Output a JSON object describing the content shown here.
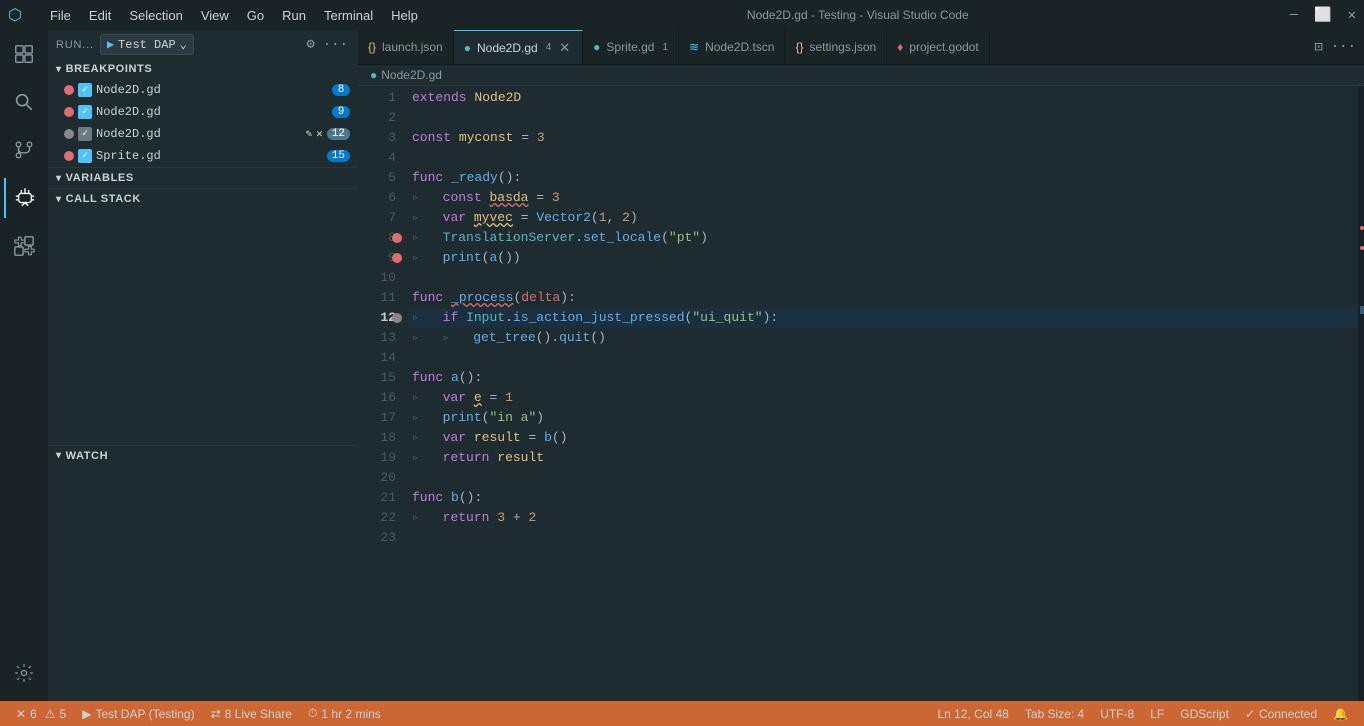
{
  "titleBar": {
    "title": "Node2D.gd - Testing - Visual Studio Code",
    "menu": [
      "File",
      "Edit",
      "Selection",
      "View",
      "Go",
      "Run",
      "Terminal",
      "Help"
    ]
  },
  "activityBar": {
    "icons": [
      {
        "name": "explorer-icon",
        "symbol": "⬜",
        "active": false
      },
      {
        "name": "search-icon",
        "symbol": "🔍",
        "active": false
      },
      {
        "name": "source-control-icon",
        "symbol": "⑂",
        "active": false
      },
      {
        "name": "debug-icon",
        "symbol": "▷",
        "active": true
      },
      {
        "name": "extensions-icon",
        "symbol": "⊞",
        "active": false
      }
    ],
    "bottom": [
      {
        "name": "settings-icon",
        "symbol": "⚙"
      }
    ]
  },
  "sidebar": {
    "runLabel": "RUN...",
    "configLabel": "Test DAP",
    "breakpointsTitle": "BREAKPOINTS",
    "variablesTitle": "VARIABLES",
    "callStackTitle": "CALL STACK",
    "watchTitle": "WATCH",
    "breakpoints": [
      {
        "file": "Node2D.gd",
        "checked": true,
        "color": "red",
        "count": "8"
      },
      {
        "file": "Node2D.gd",
        "checked": true,
        "color": "red",
        "count": "9"
      },
      {
        "file": "Node2D.gd",
        "checked": false,
        "color": "gray",
        "count": "12",
        "editing": true
      },
      {
        "file": "Sprite.gd",
        "checked": true,
        "color": "red",
        "count": "15"
      }
    ]
  },
  "tabs": [
    {
      "label": "launch.json",
      "icon": "{}",
      "active": false,
      "modified": false
    },
    {
      "label": "Node2D.gd",
      "icon": "N",
      "active": true,
      "modified": true,
      "count": "4"
    },
    {
      "label": "Sprite.gd",
      "icon": "S",
      "active": false,
      "modified": false,
      "count": "1"
    },
    {
      "label": "Node2D.tscn",
      "icon": "N",
      "active": false,
      "modified": false
    },
    {
      "label": "settings.json",
      "icon": "{}",
      "active": false,
      "modified": false
    },
    {
      "label": "project.godot",
      "icon": "G",
      "active": false,
      "modified": false
    }
  ],
  "breadcrumb": {
    "path": "Node2D.gd"
  },
  "code": {
    "lines": [
      {
        "num": 1,
        "content": "extends Node2D",
        "type": "normal"
      },
      {
        "num": 2,
        "content": "",
        "type": "normal"
      },
      {
        "num": 3,
        "content": "const myconst = 3",
        "type": "normal"
      },
      {
        "num": 4,
        "content": "",
        "type": "normal"
      },
      {
        "num": 5,
        "content": "func _ready():",
        "type": "normal"
      },
      {
        "num": 6,
        "content": "▹   const basda = 3",
        "type": "normal"
      },
      {
        "num": 7,
        "content": "▹   var myvec = Vector2(1, 2)",
        "type": "normal"
      },
      {
        "num": 8,
        "content": "▹   TranslationServer.set_locale(\"pt\")",
        "type": "breakpoint"
      },
      {
        "num": 9,
        "content": "▹   print(a())",
        "type": "breakpoint"
      },
      {
        "num": 10,
        "content": "",
        "type": "normal"
      },
      {
        "num": 11,
        "content": "func _process(delta):",
        "type": "normal"
      },
      {
        "num": 12,
        "content": "▹   if Input.is_action_just_pressed(\"ui_quit\"):",
        "type": "active"
      },
      {
        "num": 13,
        "content": "▹   ▹   get_tree().quit()",
        "type": "normal"
      },
      {
        "num": 14,
        "content": "",
        "type": "normal"
      },
      {
        "num": 15,
        "content": "func a():",
        "type": "normal"
      },
      {
        "num": 16,
        "content": "▹   var e = 1",
        "type": "normal"
      },
      {
        "num": 17,
        "content": "▹   print(\"in a\")",
        "type": "normal"
      },
      {
        "num": 18,
        "content": "▹   var result = b()",
        "type": "normal"
      },
      {
        "num": 19,
        "content": "▹   return result",
        "type": "normal"
      },
      {
        "num": 20,
        "content": "",
        "type": "normal"
      },
      {
        "num": 21,
        "content": "func b():",
        "type": "normal"
      },
      {
        "num": 22,
        "content": "▹   return 3 + 2",
        "type": "normal"
      },
      {
        "num": 23,
        "content": "",
        "type": "normal"
      }
    ]
  },
  "statusBar": {
    "debugConfig": "Test DAP (Testing)",
    "liveShare": "8 Live Share",
    "timer": "1 hr 2 mins",
    "position": "Ln 12, Col 48",
    "tabSize": "Tab Size: 4",
    "encoding": "UTF-8",
    "lineEnding": "LF",
    "language": "GDScript",
    "connected": "Connected",
    "errors": "6",
    "warnings": "5"
  }
}
